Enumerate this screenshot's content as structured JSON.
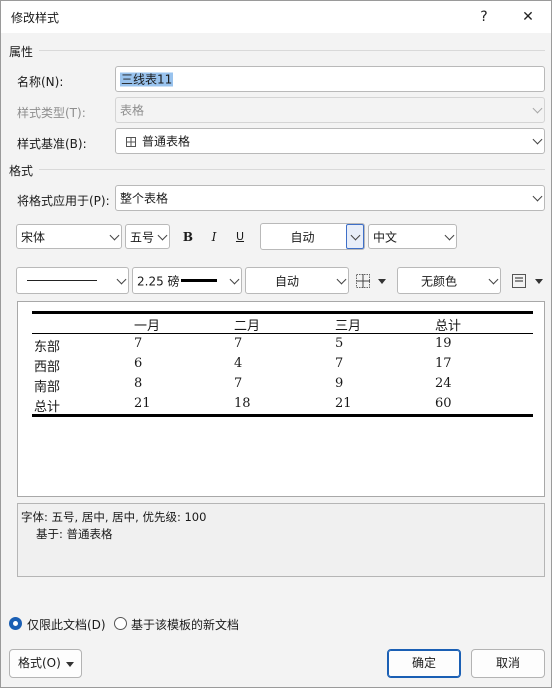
{
  "window": {
    "title": "修改样式",
    "help_label": "?",
    "close_label": "✕"
  },
  "properties": {
    "heading": "属性",
    "name_label": "名称(N):",
    "name_value": "三线表11",
    "type_label": "样式类型(T):",
    "type_value": "表格",
    "base_label": "样式基准(B):",
    "base_value": "普通表格"
  },
  "format": {
    "heading": "格式",
    "apply_label": "将格式应用于(P):",
    "apply_value": "整个表格",
    "font_value": "宋体",
    "size_value": "五号",
    "bold_label": "B",
    "italic_label": "I",
    "underline_label": "U",
    "color_value": "自动",
    "script_value": "中文",
    "line_weight_value": "2.25 磅",
    "border_color_value": "自动",
    "shading_value": "无颜色"
  },
  "preview_table": {
    "headers": [
      "",
      "一月",
      "二月",
      "三月",
      "总计"
    ],
    "rows": [
      [
        "东部",
        "7",
        "7",
        "5",
        "19"
      ],
      [
        "西部",
        "6",
        "4",
        "7",
        "17"
      ],
      [
        "南部",
        "8",
        "7",
        "9",
        "24"
      ],
      [
        "总计",
        "21",
        "18",
        "21",
        "60"
      ]
    ]
  },
  "description": {
    "line1": "字体: 五号, 居中, 居中, 优先级: 100",
    "line2": "基于: 普通表格"
  },
  "options": {
    "this_doc_label": "仅限此文档(D)",
    "template_label": "基于该模板的新文档",
    "selected": "this_doc"
  },
  "buttons": {
    "format_label": "格式(O)",
    "ok_label": "确定",
    "cancel_label": "取消"
  },
  "colors": {
    "accent": "#1a5fb4",
    "selection": "#99c3ee"
  }
}
